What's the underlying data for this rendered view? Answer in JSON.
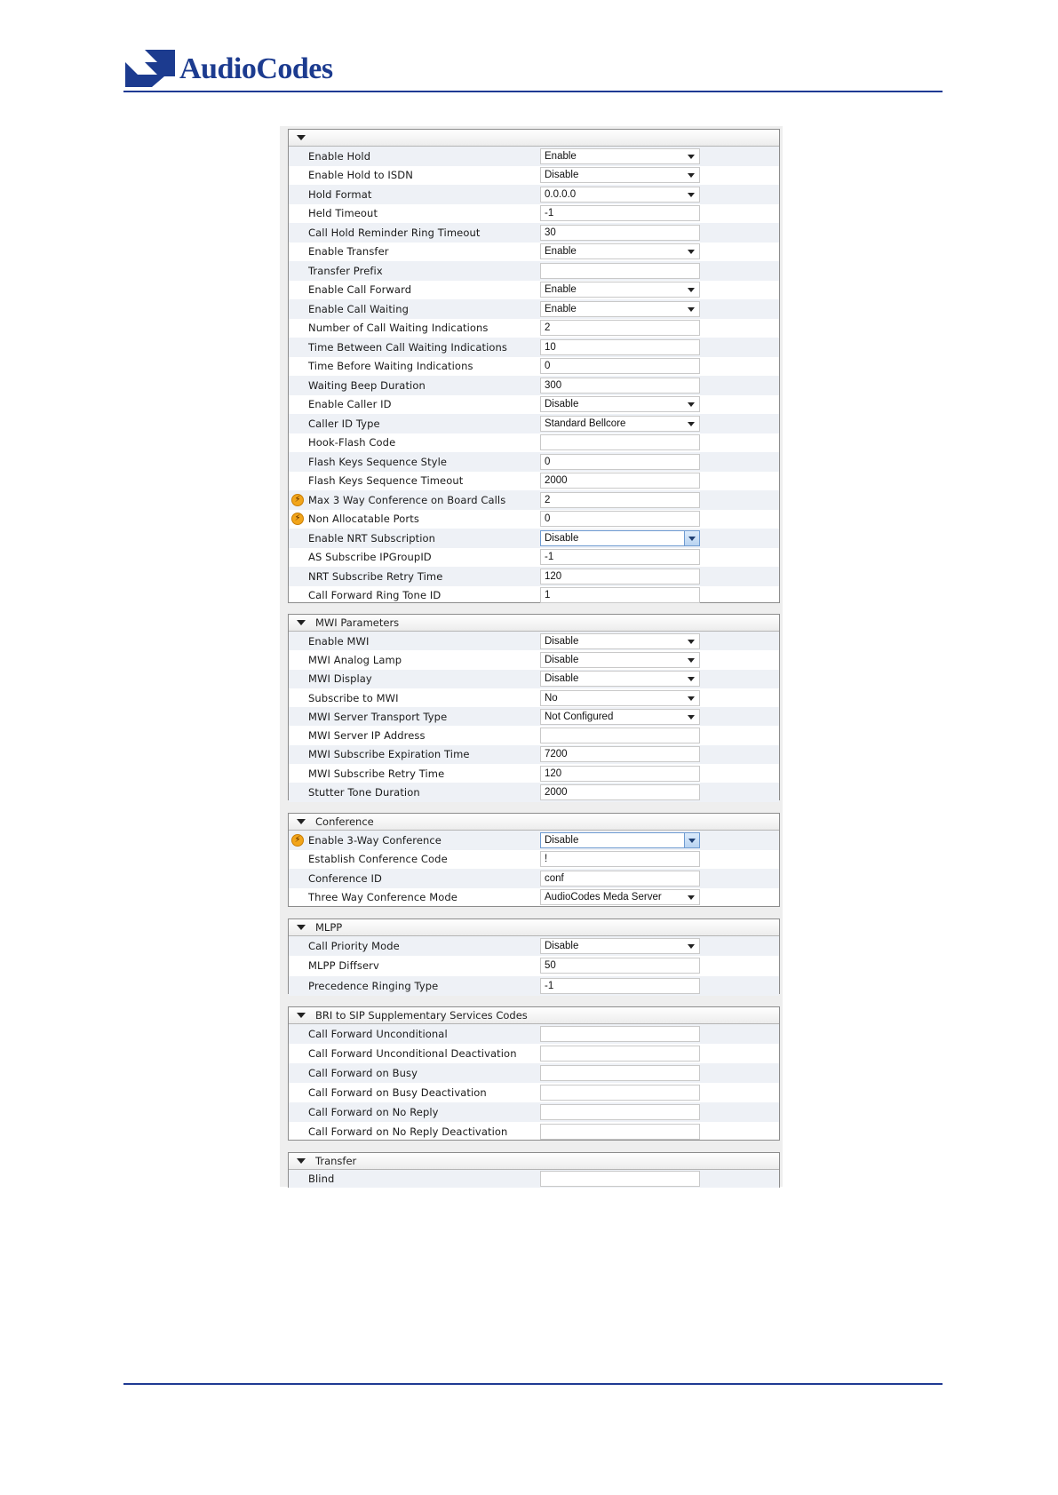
{
  "brand": {
    "logo_text": "AudioCodes",
    "color": "#1c3b8f"
  },
  "sections": [
    {
      "id": "s1",
      "title": "",
      "rows": [
        {
          "label": "Enable Hold",
          "type": "select",
          "value": "Enable"
        },
        {
          "label": "Enable Hold to ISDN",
          "type": "select",
          "value": "Disable"
        },
        {
          "label": "Hold Format",
          "type": "select",
          "value": "0.0.0.0"
        },
        {
          "label": "Held Timeout",
          "type": "input",
          "value": "-1"
        },
        {
          "label": "Call Hold Reminder Ring Timeout",
          "type": "input",
          "value": "30"
        },
        {
          "label": "Enable Transfer",
          "type": "select",
          "value": "Enable"
        },
        {
          "label": "Transfer Prefix",
          "type": "input",
          "value": ""
        },
        {
          "label": "Enable Call Forward",
          "type": "select",
          "value": "Enable"
        },
        {
          "label": "Enable Call Waiting",
          "type": "select",
          "value": "Enable"
        },
        {
          "label": "Number of Call Waiting Indications",
          "type": "input",
          "value": "2"
        },
        {
          "label": "Time Between Call Waiting Indications",
          "type": "input",
          "value": "10"
        },
        {
          "label": "Time Before Waiting Indications",
          "type": "input",
          "value": "0"
        },
        {
          "label": "Waiting Beep Duration",
          "type": "input",
          "value": "300"
        },
        {
          "label": "Enable Caller ID",
          "type": "select",
          "value": "Disable"
        },
        {
          "label": "Caller ID Type",
          "type": "select",
          "value": "Standard Bellcore"
        },
        {
          "label": "Hook-Flash Code",
          "type": "input",
          "value": ""
        },
        {
          "label": "Flash Keys Sequence Style",
          "type": "input",
          "value": "0"
        },
        {
          "label": "Flash Keys Sequence Timeout",
          "type": "input",
          "value": "2000"
        },
        {
          "label": "Max 3 Way Conference on Board Calls",
          "type": "input",
          "value": "2",
          "warn": true
        },
        {
          "label": "Non Allocatable Ports",
          "type": "input",
          "value": "0",
          "warn": true
        },
        {
          "label": "Enable NRT Subscription",
          "type": "select",
          "value": "Disable",
          "focus": true
        },
        {
          "label": "AS Subscribe IPGroupID",
          "type": "input",
          "value": "-1"
        },
        {
          "label": "NRT Subscribe Retry Time",
          "type": "input",
          "value": "120"
        },
        {
          "label": "Call Forward Ring Tone ID",
          "type": "input",
          "value": "1"
        }
      ]
    },
    {
      "id": "s2",
      "title": "MWI Parameters",
      "rows": [
        {
          "label": "Enable MWI",
          "type": "select",
          "value": "Disable"
        },
        {
          "label": "MWI Analog Lamp",
          "type": "select",
          "value": "Disable"
        },
        {
          "label": "MWI Display",
          "type": "select",
          "value": "Disable"
        },
        {
          "label": "Subscribe to MWI",
          "type": "select",
          "value": "No"
        },
        {
          "label": "MWI Server Transport Type",
          "type": "select",
          "value": "Not Configured"
        },
        {
          "label": "MWI Server IP Address",
          "type": "input",
          "value": ""
        },
        {
          "label": "MWI Subscribe Expiration Time",
          "type": "input",
          "value": "7200"
        },
        {
          "label": "MWI Subscribe Retry Time",
          "type": "input",
          "value": "120"
        },
        {
          "label": "Stutter Tone Duration",
          "type": "input",
          "value": "2000"
        }
      ]
    },
    {
      "id": "s3",
      "title": "Conference",
      "rows": [
        {
          "label": "Enable 3-Way Conference",
          "type": "select",
          "value": "Disable",
          "warn": true,
          "focus": true
        },
        {
          "label": "Establish Conference Code",
          "type": "input",
          "value": "!"
        },
        {
          "label": "Conference ID",
          "type": "input",
          "value": "conf"
        },
        {
          "label": "Three Way Conference Mode",
          "type": "select",
          "value": "AudioCodes Meda Server"
        }
      ]
    },
    {
      "id": "s4",
      "title": "MLPP",
      "rows": [
        {
          "label": "Call Priority Mode",
          "type": "select",
          "value": "Disable"
        },
        {
          "label": "MLPP Diffserv",
          "type": "input",
          "value": "50"
        },
        {
          "label": "Precedence Ringing Type",
          "type": "input",
          "value": "-1"
        }
      ]
    },
    {
      "id": "s5",
      "title": "BRI to SIP Supplementary Services Codes",
      "rows": [
        {
          "label": "Call Forward Unconditional",
          "type": "input",
          "value": ""
        },
        {
          "label": "Call Forward Unconditional Deactivation",
          "type": "input",
          "value": ""
        },
        {
          "label": "Call Forward on Busy",
          "type": "input",
          "value": ""
        },
        {
          "label": "Call Forward on Busy Deactivation",
          "type": "input",
          "value": ""
        },
        {
          "label": "Call Forward on No Reply",
          "type": "input",
          "value": ""
        },
        {
          "label": "Call Forward on No Reply Deactivation",
          "type": "input",
          "value": ""
        }
      ]
    },
    {
      "id": "s6",
      "title": "Transfer",
      "rows": [
        {
          "label": "Blind",
          "type": "input",
          "value": ""
        }
      ]
    }
  ]
}
